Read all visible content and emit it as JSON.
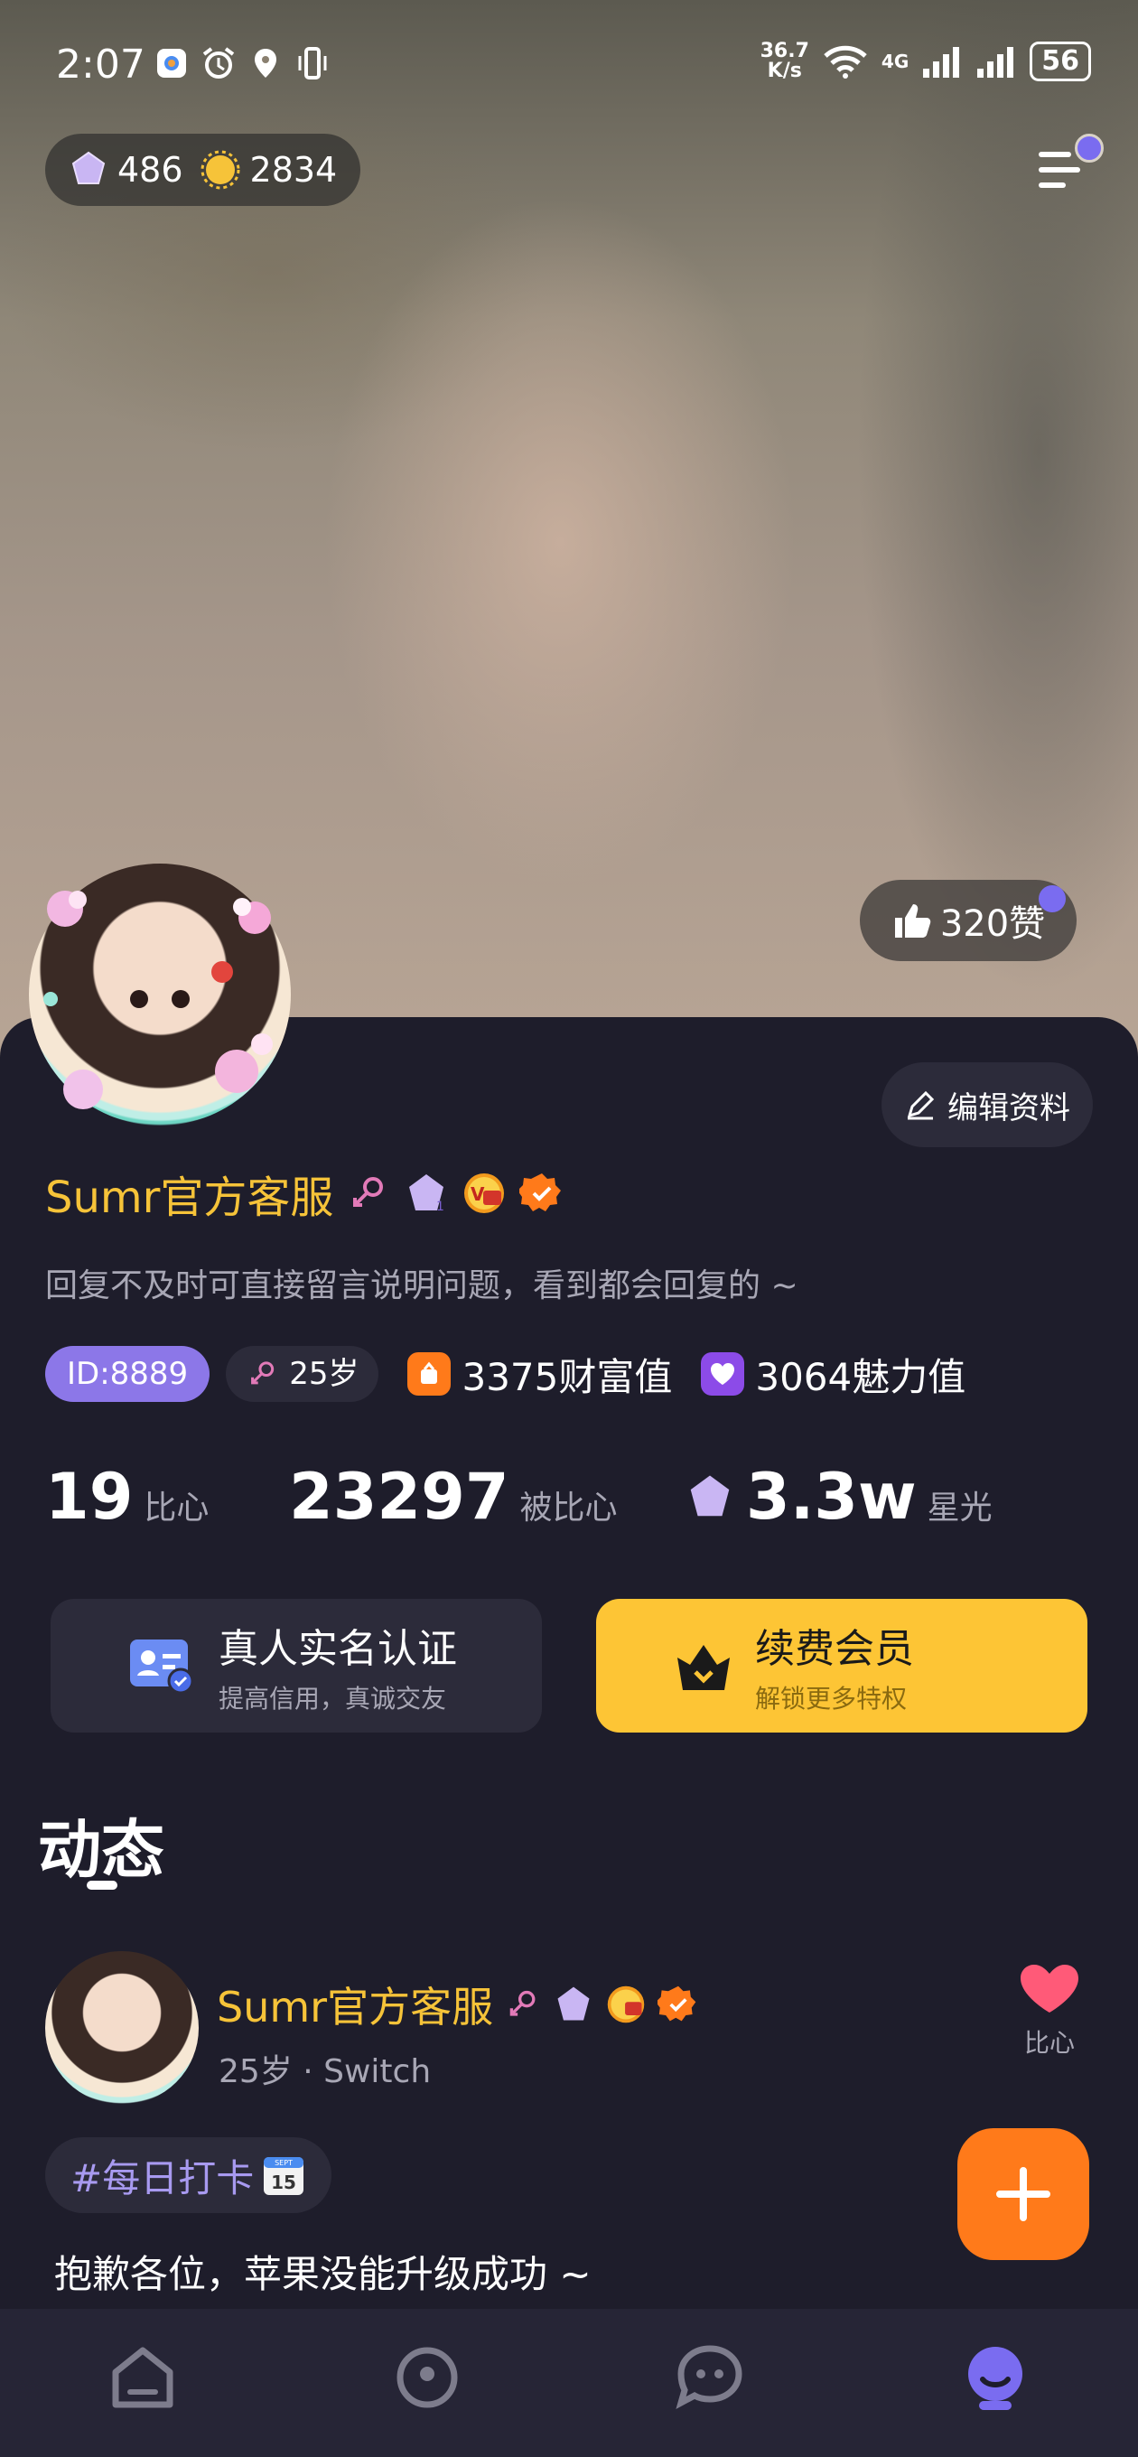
{
  "status_bar": {
    "time": "2:07",
    "net_speed_value": "36.7",
    "net_speed_unit": "K/s",
    "network": "4G",
    "battery": "56"
  },
  "wallet": {
    "gems": "486",
    "coins": "2834"
  },
  "likes": {
    "count": "320赞"
  },
  "profile": {
    "edit_label": "编辑资料",
    "name": "Sumr官方客服",
    "bio": "回复不及时可直接留言说明问题，看到都会回复的 ~",
    "id": "ID:8889",
    "age": "25岁",
    "wealth": "3375财富值",
    "charm": "3064魅力值"
  },
  "stats": [
    {
      "value": "19",
      "label": "比心"
    },
    {
      "value": "23297",
      "label": "被比心"
    },
    {
      "value": "3.3w",
      "label": "星光"
    }
  ],
  "cards": {
    "verify_title": "真人实名认证",
    "verify_sub": "提高信用，真诚交友",
    "vip_title": "续费会员",
    "vip_sub": "解锁更多特权"
  },
  "section": {
    "title": "动态"
  },
  "post": {
    "author": "Sumr官方客服",
    "meta": "25岁 · Switch",
    "like_label": "比心",
    "topic": "#每日打卡",
    "calendar_month": "SEPT",
    "calendar_day": "15",
    "text": "抱歉各位，苹果没能升级成功 ~"
  },
  "colors": {
    "accent": "#7a6cf0",
    "gold": "#f6c339",
    "vip": "#fdc535",
    "fab": "#ff7a1a",
    "panel": "#1e1d2b",
    "heart": "#ff5a78"
  },
  "tabs": [
    {
      "icon": "home-icon"
    },
    {
      "icon": "discover-icon"
    },
    {
      "icon": "message-icon"
    },
    {
      "icon": "profile-icon"
    }
  ]
}
